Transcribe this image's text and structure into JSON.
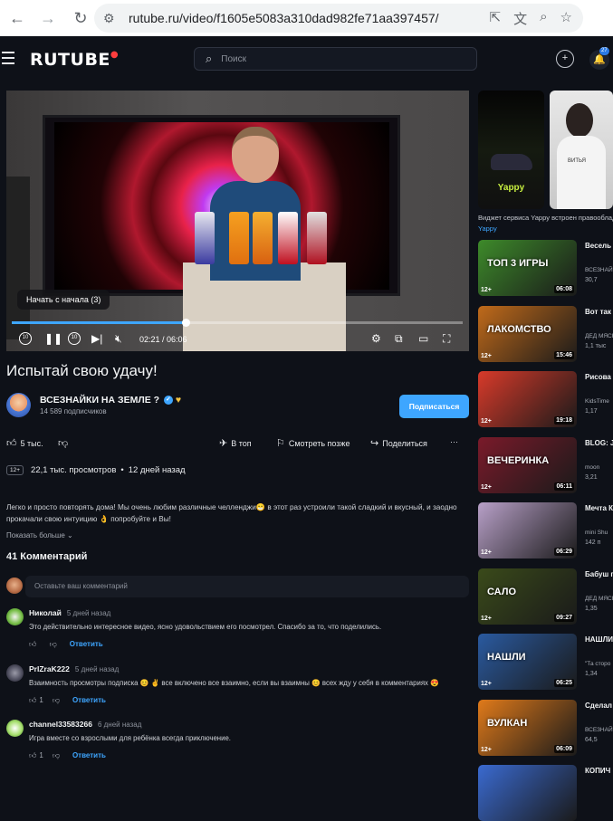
{
  "browser": {
    "url": "rutube.ru/video/f1605e5083a310dad982fe71aa397457/"
  },
  "header": {
    "logo": "RUTUBE",
    "search_placeholder": "Поиск",
    "notifications_count": "27"
  },
  "player": {
    "resume_tooltip": "Начать с начала (3)",
    "time": "02:21 / 06:06",
    "progress_fraction": 0.385,
    "skip_seconds": "10"
  },
  "video": {
    "title": "Испытай свою удачу!",
    "channel_name": "ВСЕЗНАЙКИ НА ЗЕМЛЕ ?",
    "subscribers": "14 589 подписчиков",
    "subscribe_label": "Подписаться",
    "likes": "5 тыс.",
    "actions": {
      "top": "В топ",
      "watch_later": "Смотреть позже",
      "share": "Поделиться"
    },
    "age_rating": "12+",
    "views": "22,1 тыс. просмотров",
    "published": "12 дней назад",
    "description": "Легко и просто повторять дома! Мы очень любим различные челленджи😁 в этот раз устроили такой сладкий и вкусный, и заодно прокачали свою интуицию 👌 попробуйте и Вы!",
    "show_more": "Показать больше"
  },
  "comments": {
    "title": "41 Комментарий",
    "input_placeholder": "Оставьте ваш комментарий",
    "reply_label": "Ответить",
    "items": [
      {
        "author": "Николай",
        "time": "5 дней назад",
        "text": "Это действительно интересное видео, ясно удовольствием его посмотрел. Спасибо за то, что поделились.",
        "likes": ""
      },
      {
        "author": "PrIZraK222",
        "time": "5 дней назад",
        "text": "Взаимность просмотры подписка 😊 ✌️ все включено все взаимно, если вы взаимны 😊 всех жду у себя в комментариях 😍",
        "likes": "1"
      },
      {
        "author": "channel33583266",
        "time": "6 дней назад",
        "text": "Игра вместе со взрослыми для ребёнка всегда приключение.",
        "likes": "1"
      }
    ]
  },
  "sidebar": {
    "shorts_caption": "Виджет сервиса Yappy встроен правообладателем",
    "shorts_brand": "Yappy",
    "shorts_thumbs": [
      {
        "label": "Yappy"
      },
      {
        "label": "ВИТЬЯ"
      }
    ],
    "recommendations": [
      {
        "title": "Весель Всех!",
        "channel": "ВСЕЗНАЙ",
        "views": "30,7",
        "age": "12+",
        "duration": "06:08",
        "overlay": "ТОП 3 ИГРЫ",
        "color": "#3d8a2a"
      },
      {
        "title": "Вот так куриную",
        "channel": "ДЕД МЯСН",
        "views": "1,1 тыс",
        "age": "12+",
        "duration": "15:46",
        "overlay": "ЛАКОМСТВО",
        "color": "#c06a1a"
      },
      {
        "title": "Рисова раскрас",
        "channel": "KidsTime",
        "views": "1,17",
        "age": "12+",
        "duration": "19:18",
        "overlay": "",
        "color": "#d83a2a"
      },
      {
        "title": "BLOG: JOLLYEA",
        "channel": "moon",
        "views": "3,21",
        "age": "12+",
        "duration": "06:11",
        "overlay": "ВЕЧЕРИНКА",
        "color": "#7a1a2a"
      },
      {
        "title": "Мечта Котёно",
        "channel": "mini Shu",
        "views": "142 п",
        "age": "12+",
        "duration": "06:29",
        "overlay": "",
        "color": "#b8a0c8"
      },
      {
        "title": "Бабуш грудин",
        "channel": "ДЕД МЯСН",
        "views": "1,35",
        "age": "12+",
        "duration": "09:27",
        "overlay": "САЛО",
        "color": "#3a4a1a"
      },
      {
        "title": "НАШЛИ ИНОПЛА",
        "channel": "\"Та сторо",
        "views": "1,34",
        "age": "12+",
        "duration": "06:25",
        "overlay": "НАШЛИ",
        "color": "#2a5aa0"
      },
      {
        "title": "Сделал вулкан!",
        "channel": "ВСЕЗНАЙ",
        "views": "64,5",
        "age": "12+",
        "duration": "06:09",
        "overlay": "ВУЛКАН",
        "color": "#e07a1a"
      },
      {
        "title": "КОПИЧ",
        "channel": "",
        "views": "",
        "age": "",
        "duration": "",
        "overlay": "",
        "color": "#3a6ad0"
      }
    ]
  }
}
